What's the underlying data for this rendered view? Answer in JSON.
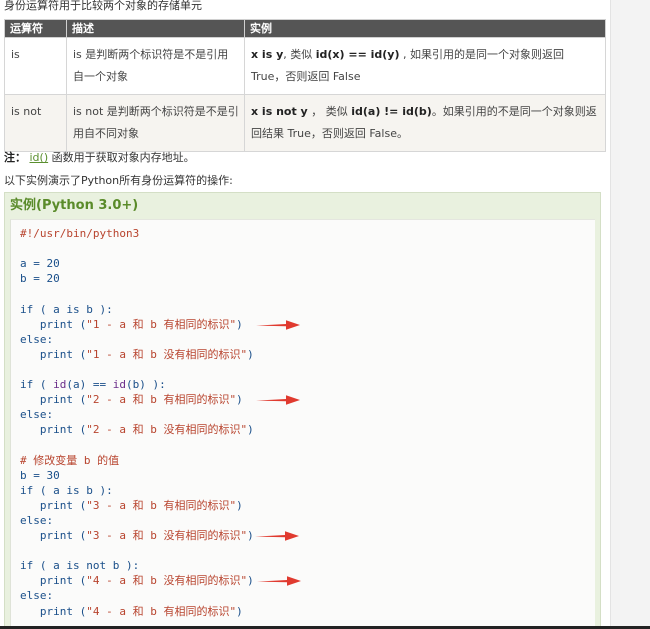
{
  "intro": "身份运算符用于比较两个对象的存储单元",
  "table": {
    "headers": [
      "运算符",
      "描述",
      "实例"
    ],
    "rows": [
      {
        "op": "is",
        "desc": "is 是判断两个标识符是不是引用自一个对象",
        "example_code": "x is y",
        "example_mid": ", 类似 ",
        "example_code2": "id(x) == id(y)",
        "example_rest": " , 如果引用的是同一个对象则返回 True，否则返回 False"
      },
      {
        "op": "is not",
        "desc": "is not 是判断两个标识符是不是引用自不同对象",
        "example_code": "x is not y",
        "example_mid": " ， 类似 ",
        "example_code2": "id(a) != id(b)",
        "example_rest": "。如果引用的不是同一个对象则返回结果 True，否则返回 False。"
      }
    ]
  },
  "note": {
    "label": "注：",
    "link": "id()",
    "text": " 函数用于获取对象内存地址。"
  },
  "desc_line": "以下实例演示了Python所有身份运算符的操作:",
  "example": {
    "title": "实例(Python 3.0+)",
    "lines": [
      "#!/usr/bin/python3",
      "",
      "a = 20",
      "b = 20",
      "",
      "if ( a is b ):",
      "   print (\"1 - a 和 b 有相同的标识\")",
      "else:",
      "   print (\"1 - a 和 b 没有相同的标识\")",
      "",
      "if ( id(a) == id(b) ):",
      "   print (\"2 - a 和 b 有相同的标识\")",
      "else:",
      "   print (\"2 - a 和 b 没有相同的标识\")",
      "",
      "# 修改变量 b 的值",
      "b = 30",
      "if ( a is b ):",
      "   print (\"3 - a 和 b 有相同的标识\")",
      "else:",
      "   print (\"3 - a 和 b 没有相同的标识\")",
      "",
      "if ( a is not b ):",
      "   print (\"4 - a 和 b 没有相同的标识\")",
      "else:",
      "   print (\"4 - a 和 b 有相同的标识\")"
    ],
    "arrow_color": "#e03a2f"
  }
}
